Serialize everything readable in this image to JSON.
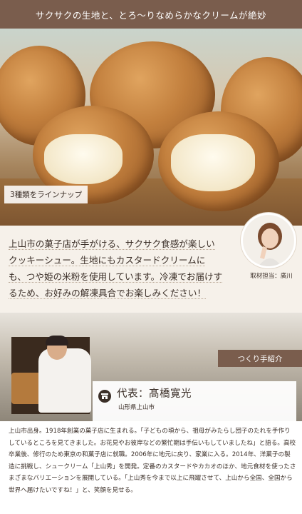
{
  "header": {
    "text": "サクサクの生地と、とろ〜りなめらかなクリームが絶妙"
  },
  "photo": {
    "label": "3種類をラインナップ"
  },
  "description": {
    "lines": [
      "上山市の菓子店が手がける、サクサク食感が楽しい",
      "クッキーシュー。生地にもカスタードクリームに",
      "も、つや姫の米粉を使用しています。冷凍でお届けす",
      "るため、お好みの解凍具合でお楽しみください！"
    ]
  },
  "reporter": {
    "caption": "取材担当：廣川"
  },
  "maker": {
    "tag": "つくり手紹介",
    "name": "代表：髙橋寛光",
    "place": "山形県上山市",
    "bio": "上山市出身。1918年創業の菓子店に生まれる。「子どもの頃から、祖母がみたらし団子のたれを手作りしているところを見てきました。お花見やお彼岸などの繁忙期は手伝いもしていましたね」と語る。高校卒業後、修行のため東京の和菓子店に就職。2006年に地元に戻り、家業に入る。2014年、洋菓子の製造に挑戦し、シュークリーム「上山秀」を開発。定番のカスタードやカカオのほか、地元食材を使ったさまざまなバリエーションを展開している。「上山秀を今まで以上に飛躍させて、上山から全国、全国から世界へ届けたいですね！」と、笑顔を見せる。"
  },
  "colors": {
    "brand_brown": "#7a5d4d",
    "background": "#f6f1ea"
  }
}
